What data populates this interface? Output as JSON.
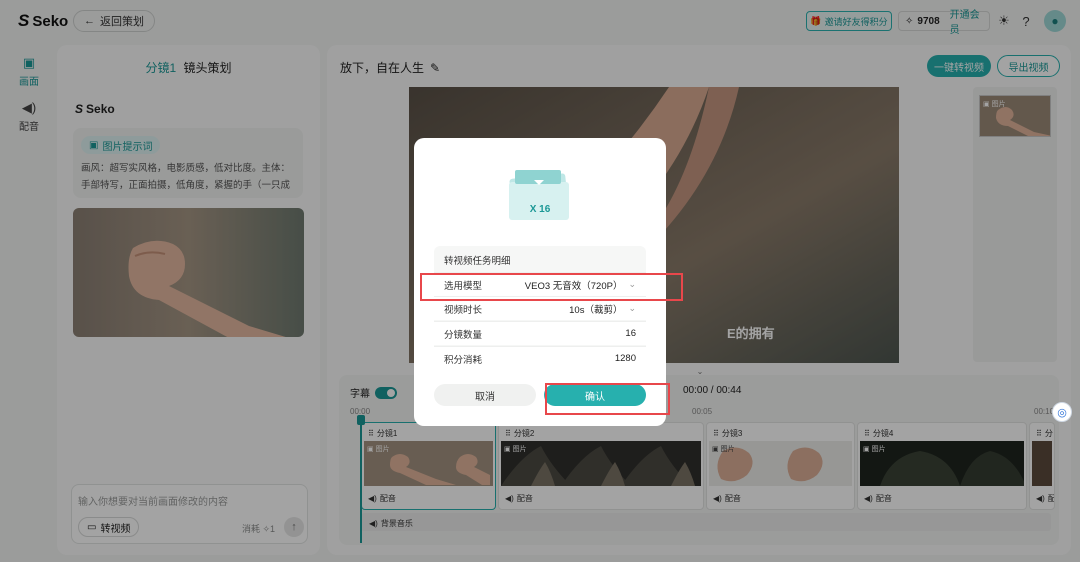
{
  "app": {
    "name": "Seko",
    "back_label": "返回策划"
  },
  "topbar": {
    "invite_label": "邀请好友得积分",
    "credits": "9708",
    "member_label": "开通会员"
  },
  "rail": [
    {
      "label": "画面"
    },
    {
      "label": "配音"
    }
  ],
  "left_panel": {
    "title_accent": "分镜1",
    "title": "镜头策划",
    "brand": "Seko",
    "prompt_tag": "图片提示词",
    "prompt_text": "画风：超写实风格，电影质感，低对比度。主体：手部特写，正面拍摄，低角度，紧握的手（一只成年女",
    "edit_placeholder": "输入你想要对当前画面修改的内容",
    "to_video_label": "转视频",
    "cost_label": "消耗 ✧1"
  },
  "main": {
    "project_title": "放下，自在人生",
    "convert_label": "一键转视频",
    "export_label": "导出视频",
    "subtitle_text": "E的拥有",
    "side_thumb_tag": "图片"
  },
  "timeline": {
    "caption_label": "字幕",
    "time": "00:00 / 00:44",
    "ruler": [
      "00:00",
      "00:05",
      "00:10"
    ],
    "clips": [
      {
        "name": "分镜1",
        "tag": "图片",
        "audio": "配音"
      },
      {
        "name": "分镜2",
        "tag": "图片",
        "audio": "配音"
      },
      {
        "name": "分镜3",
        "tag": "图片",
        "audio": "配音"
      },
      {
        "name": "分镜4",
        "tag": "图片",
        "audio": "配音"
      },
      {
        "name": "分",
        "tag": "",
        "audio": "配"
      }
    ],
    "bgm_label": "背景音乐"
  },
  "modal": {
    "multiplier": "X 16",
    "detail_title": "转视频任务明细",
    "rows": [
      {
        "label": "选用模型",
        "value": "VEO3 无音效（720P）"
      },
      {
        "label": "视频时长",
        "value": "10s（裁剪）"
      },
      {
        "label": "分镜数量",
        "value": "16"
      },
      {
        "label": "积分消耗",
        "value": "1280"
      }
    ],
    "cancel_label": "取消",
    "confirm_label": "确认"
  },
  "colors": {
    "accent": "#27b0ae",
    "highlight": "#e8474b"
  }
}
